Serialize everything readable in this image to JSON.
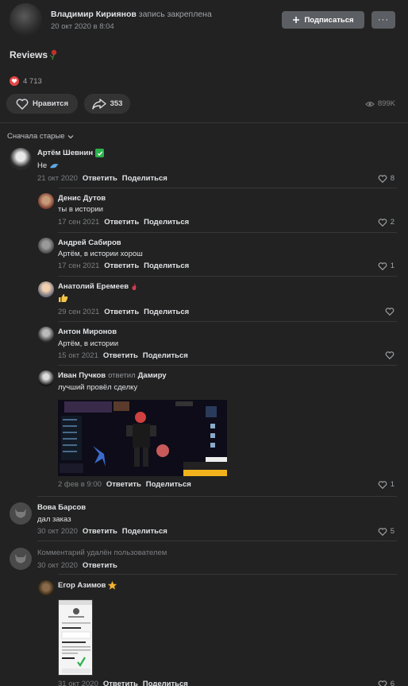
{
  "post": {
    "author": "Владимир Кириянов",
    "action": "запись закреплена",
    "date": "20 окт 2020 в 8:04",
    "subscribe_label": "Подписаться",
    "more_label": "···",
    "text": "Reviews",
    "reactions_count": "4 713",
    "like_label": "Нравится",
    "share_count": "353",
    "views": "899K"
  },
  "sort_label": "Сначала старые",
  "colors": {
    "background": "#222222",
    "button": "#5b5e62",
    "pill": "#333333",
    "text": "#e1e3e6",
    "muted": "#7d7f83",
    "heart": "#e64646",
    "verified": "#2bb24c"
  },
  "comments": [
    {
      "name": "Артём Шевнин",
      "badge": "verified-icon",
      "text": "Не",
      "date": "21 окт 2020",
      "reply": "Ответить",
      "share": "Поделиться",
      "likes": "8"
    },
    {
      "name": "Денис Дутов",
      "text": "ты в истории",
      "date": "17 сен 2021",
      "reply": "Ответить",
      "share": "Поделиться",
      "likes": "2"
    },
    {
      "name": "Андрей Сабиров",
      "text": "Артём, в истории хорош",
      "date": "17 сен 2021",
      "reply": "Ответить",
      "share": "Поделиться",
      "likes": "1"
    },
    {
      "name": "Анатолий Еремеев",
      "badge": "flame-icon",
      "text": "",
      "date": "29 сен 2021",
      "reply": "Ответить",
      "share": "Поделиться",
      "likes": ""
    },
    {
      "name": "Антон Миронов",
      "text": "Артём, в истории",
      "date": "15 окт 2021",
      "reply": "Ответить",
      "share": "Поделиться",
      "likes": ""
    },
    {
      "name": "Иван Пучков",
      "replied": "ответил",
      "replied_to": "Дамиру",
      "text": "лучший провёл сделку",
      "date": "2 фев в 9:00",
      "reply": "Ответить",
      "share": "Поделиться",
      "likes": "1"
    },
    {
      "name": "Вова Барсов",
      "text": "дал заказ",
      "date": "30 окт 2020",
      "reply": "Ответить",
      "share": "Поделиться",
      "likes": "5"
    },
    {
      "deleted_text": "Комментарий удалён пользователем",
      "date": "30 окт 2020",
      "reply": "Ответить"
    },
    {
      "name": "Егор Азимов",
      "badge": "star-icon",
      "date": "31 окт 2020",
      "reply": "Ответить",
      "share": "Поделиться",
      "likes": "6"
    }
  ]
}
